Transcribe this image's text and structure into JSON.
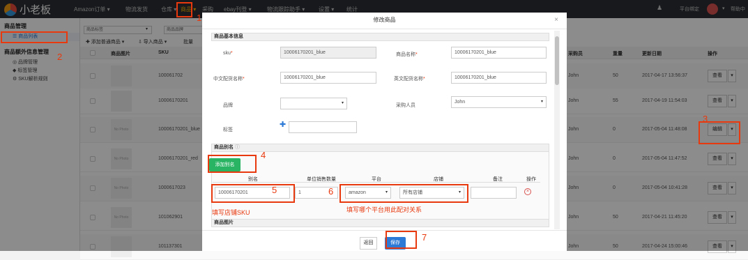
{
  "app": {
    "name": "小老板"
  },
  "topnav": {
    "items": [
      "Amazon订单 ▾",
      "物流发货",
      "仓库 ▾",
      "商品 ▾",
      "采购",
      "ebay刊登 ▾",
      "物流跟踪助手 ▾",
      "设置 ▾",
      "统计"
    ],
    "platform_bind": "平台绑定",
    "help": "帮助中"
  },
  "sidebar": {
    "product_mgmt": "商品管理",
    "product_list": "☰ 商品列表",
    "extra_info": "商品额外信息管理",
    "brand": "◎ 品牌管理",
    "tags": "◆ 标签管理",
    "sku_rules": "⚙ SKU解析规则"
  },
  "filters": {
    "tag": "商品标签",
    "brand": "商品品牌"
  },
  "toolbar": {
    "add": "✚ 添加普通商品 ▾",
    "import": "⇩ 导入商品 ▾",
    "bulk": "批量"
  },
  "table": {
    "headers": {
      "img": "商品图片",
      "sku": "SKU",
      "buyer": "采购员",
      "weight": "重量",
      "updated": "更新日期",
      "ops": "操作"
    },
    "rows": [
      {
        "sku": "100061702",
        "buyer": "John",
        "weight": "50",
        "date": "2017-04-17 13:56:37",
        "action": "查看",
        "img": ""
      },
      {
        "sku": "10006170201",
        "buyer": "John",
        "weight": "55",
        "date": "2017-04-19 11:54:03",
        "action": "查看",
        "img": ""
      },
      {
        "sku": "10006170201_blue",
        "buyer": "John",
        "weight": "0",
        "date": "2017-05-04 11:48:08",
        "action": "编辑",
        "img": "No Photo"
      },
      {
        "sku": "10006170201_red",
        "buyer": "John",
        "weight": "0",
        "date": "2017-05-04 11:47:52",
        "action": "查看",
        "img": "No Photo"
      },
      {
        "sku": "1000617023",
        "buyer": "John",
        "weight": "0",
        "date": "2017-05-04 10:41:28",
        "action": "查看",
        "img": "No Photo"
      },
      {
        "sku": "101062901",
        "buyer": "John",
        "weight": "50",
        "date": "2017-04-21 11:45:20",
        "action": "查看",
        "img": "No Photo"
      },
      {
        "sku": "101137301",
        "buyer": "John",
        "weight": "50",
        "date": "2017-04-24 15:00:46",
        "action": "查看",
        "img": ""
      }
    ]
  },
  "modal": {
    "title": "修改商品",
    "section_basic": "商品基本信息",
    "sku_label": "sku",
    "sku_value": "10006170201_blue",
    "name_label": "商品名称",
    "name_value": "10006170201_blue",
    "cn_decl_label": "中文配货名称",
    "cn_decl_value": "10006170201_blue",
    "en_decl_label": "英文配货名称",
    "en_decl_value": "10006170201_blue",
    "brand_label": "品牌",
    "brand_value": "",
    "buyer_label": "采购人员",
    "buyer_value": "John",
    "tag_label": "标签",
    "tag_value": "",
    "section_alias": "商品别名",
    "add_alias": "添加别名",
    "alias_headers": {
      "alias": "别名",
      "unit_qty": "单位销售数量",
      "platform": "平台",
      "store": "店铺",
      "note": "备注",
      "ops": "操作"
    },
    "alias_row": {
      "alias": "10006170201",
      "qty": "1",
      "platform": "amazon",
      "store": "所有店铺",
      "note": ""
    },
    "section_images": "商品图片",
    "back": "返回",
    "save": "保存"
  },
  "annotations": {
    "n1": "1",
    "n2": "2",
    "n3": "3",
    "n4": "4",
    "n5": "5",
    "n6": "6",
    "n7": "7",
    "note5": "填写店铺SKU",
    "note6": "填写哪个平台用此配对关系"
  }
}
